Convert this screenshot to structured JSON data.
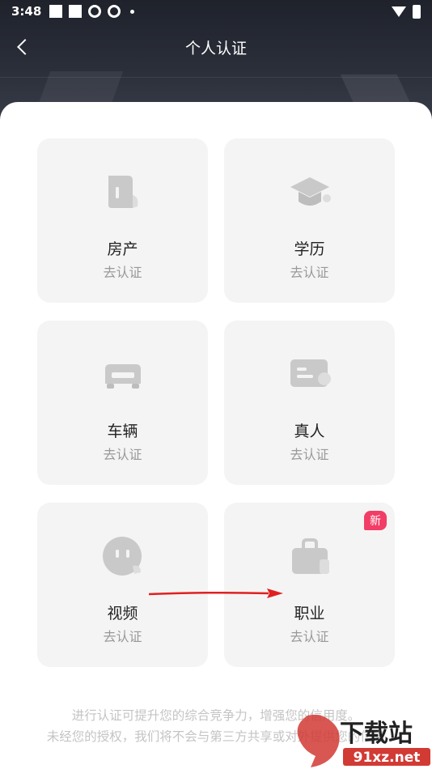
{
  "status_bar": {
    "time": "3:48"
  },
  "nav": {
    "title": "个人认证"
  },
  "cards": [
    {
      "title": "房产",
      "subtitle": "去认证",
      "icon": "house-icon"
    },
    {
      "title": "学历",
      "subtitle": "去认证",
      "icon": "graduation-cap-icon"
    },
    {
      "title": "车辆",
      "subtitle": "去认证",
      "icon": "car-icon"
    },
    {
      "title": "真人",
      "subtitle": "去认证",
      "icon": "id-card-icon"
    },
    {
      "title": "视频",
      "subtitle": "去认证",
      "icon": "video-face-icon"
    },
    {
      "title": "职业",
      "subtitle": "去认证",
      "icon": "briefcase-icon",
      "badge": "新"
    }
  ],
  "footer": {
    "line1": "进行认证可提升您的综合竞争力，增强您的信用度。",
    "line2": "未经您的授权，我们将不会与第三方共享或对外提供您的信息"
  },
  "watermark": {
    "brand": "下载站",
    "site": "91xz.net"
  },
  "colors": {
    "header": "#2b2f3a",
    "card_bg": "#f4f4f4",
    "badge": "#f23d66",
    "arrow": "#e02020"
  }
}
